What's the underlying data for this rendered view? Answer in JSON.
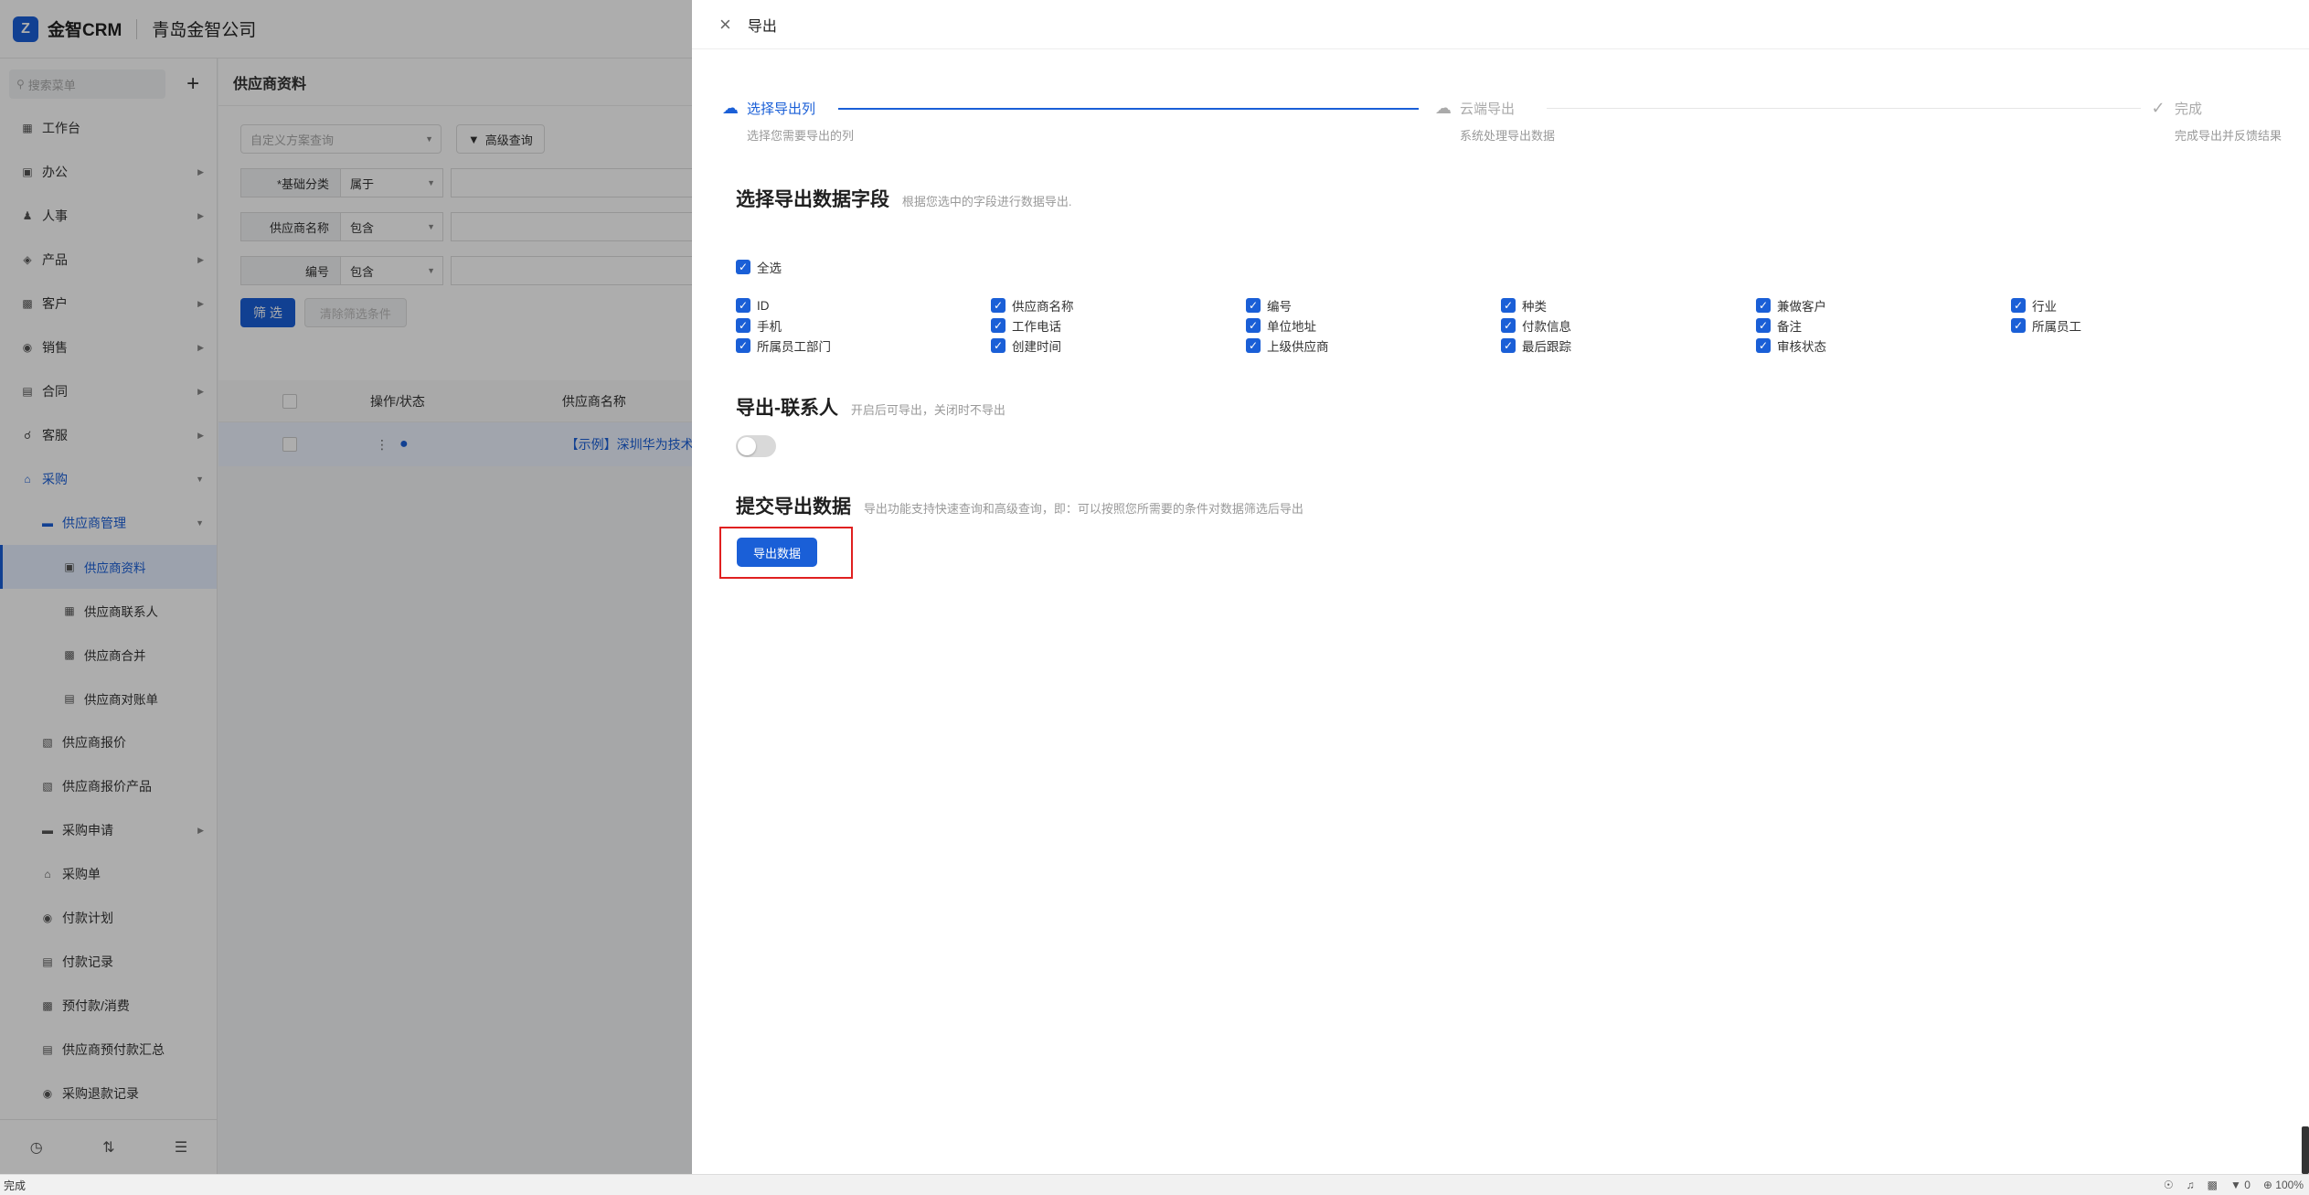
{
  "app": {
    "logo_text": "金智CRM",
    "company": "青岛金智公司"
  },
  "sidebar": {
    "search_placeholder": "搜索菜单",
    "items": [
      {
        "label": "工作台",
        "icon": "dashboard-icon"
      },
      {
        "label": "办公",
        "icon": "monitor-icon"
      },
      {
        "label": "人事",
        "icon": "people-icon"
      },
      {
        "label": "产品",
        "icon": "box-icon"
      },
      {
        "label": "客户",
        "icon": "customer-icon"
      },
      {
        "label": "销售",
        "icon": "sales-icon"
      },
      {
        "label": "合同",
        "icon": "contract-icon"
      },
      {
        "label": "客服",
        "icon": "headset-icon"
      },
      {
        "label": "采购",
        "icon": "cart-icon"
      },
      {
        "label": "供应商管理",
        "icon": "folder-icon"
      },
      {
        "label": "供应商资料",
        "icon": "supplier-icon"
      },
      {
        "label": "供应商联系人",
        "icon": "contact-icon"
      },
      {
        "label": "供应商合并",
        "icon": "merge-icon"
      },
      {
        "label": "供应商对账单",
        "icon": "statement-icon"
      },
      {
        "label": "供应商报价",
        "icon": "quote-icon"
      },
      {
        "label": "供应商报价产品",
        "icon": "quote-product-icon"
      },
      {
        "label": "采购申请",
        "icon": "request-icon"
      },
      {
        "label": "采购单",
        "icon": "order-icon"
      },
      {
        "label": "付款计划",
        "icon": "plan-icon"
      },
      {
        "label": "付款记录",
        "icon": "record-icon"
      },
      {
        "label": "预付款/消费",
        "icon": "prepay-icon"
      },
      {
        "label": "供应商预付款汇总",
        "icon": "summary-icon"
      },
      {
        "label": "采购退款记录",
        "icon": "refund-icon"
      }
    ]
  },
  "main": {
    "page_title": "供应商资料",
    "scheme_placeholder": "自定义方案查询",
    "advanced_query": "高级查询",
    "filters": [
      {
        "label": "*基础分类",
        "op": "属于"
      },
      {
        "label": "供应商名称",
        "op": "包含"
      },
      {
        "label": "编号",
        "op": "包含"
      }
    ],
    "filter_button": "筛 选",
    "clear_button": "清除筛选条件",
    "columns": [
      "操作/状态",
      "供应商名称"
    ],
    "row": {
      "name": "【示例】深圳华为技术有"
    }
  },
  "drawer": {
    "title": "导出",
    "steps": [
      {
        "title": "选择导出列",
        "desc": "选择您需要导出的列"
      },
      {
        "title": "云端导出",
        "desc": "系统处理导出数据"
      },
      {
        "title": "完成",
        "desc": "完成导出并反馈结果"
      }
    ],
    "fields_section": {
      "title": "选择导出数据字段",
      "desc": "根据您选中的字段进行数据导出."
    },
    "select_all": "全选",
    "fields": [
      "ID",
      "供应商名称",
      "编号",
      "种类",
      "兼做客户",
      "行业",
      "手机",
      "工作电话",
      "单位地址",
      "付款信息",
      "备注",
      "所属员工",
      "所属员工部门",
      "创建时间",
      "上级供应商",
      "最后跟踪",
      "审核状态"
    ],
    "contacts_section": {
      "title": "导出-联系人",
      "desc": "开启后可导出，关闭时不导出"
    },
    "contacts_enabled": false,
    "submit_section": {
      "title": "提交导出数据",
      "desc": "导出功能支持快速查询和高级查询，即：可以按照您所需要的条件对数据筛选后导出"
    },
    "export_button": "导出数据"
  },
  "statusbar": {
    "left": "完成",
    "counter": "0",
    "zoom": "100%"
  },
  "colors": {
    "primary": "#1a5fd7",
    "highlight_border": "#e02020"
  }
}
